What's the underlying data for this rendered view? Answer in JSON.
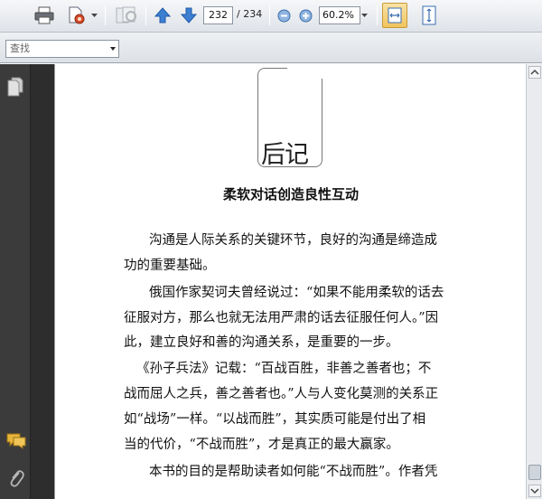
{
  "toolbar": {
    "page_current": "232",
    "page_total": "/ 234",
    "zoom": "60.2%"
  },
  "search": {
    "placeholder": "查找"
  },
  "document": {
    "chapter_title": "后记",
    "section_title": "柔软对话创造良性互动",
    "lines": [
      "沟通是人际关系的关键环节，良好的沟通是缔造成",
      "功的重要基础。",
      "俄国作家契诃夫曾经说过：“如果不能用柔软的话去",
      "征服对方，那么也就无法用严肃的话去征服任何人。”因",
      "此，建立良好和善的沟通关系，是重要的一步。",
      "《孙子兵法》记载：“百战百胜，非善之善者也；不",
      "战而屈人之兵，善之善者也。”人与人变化莫测的关系正",
      "如“战场”一样。“以战而胜”，其实质可能是付出了相",
      "当的代价，“不战而胜”，才是真正的最大赢家。",
      "本书的目的是帮助读者如何能“不战而胜”。作者凭"
    ]
  }
}
